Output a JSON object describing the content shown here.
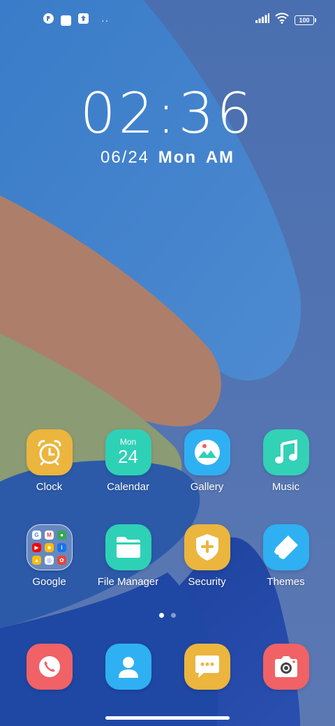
{
  "status_bar": {
    "left_icons": [
      "notification-app-icon",
      "notification-square-icon",
      "upload-icon",
      "more-notifications-icon"
    ],
    "battery": "100"
  },
  "clock": {
    "time": "02:36",
    "date": "06/24",
    "weekday": "Mon",
    "ampm": "AM"
  },
  "apps_row1": [
    {
      "label": "Clock",
      "color": "#EBB53E"
    },
    {
      "label": "Calendar",
      "color": "#2ED1B6",
      "month_abbr": "Mon",
      "day": "24"
    },
    {
      "label": "Gallery",
      "color": "#2FB0F2"
    },
    {
      "label": "Music",
      "color": "#33D1B6"
    }
  ],
  "apps_row2": [
    {
      "label": "Google",
      "folder_apps": [
        "G",
        "M",
        "Maps",
        "YT",
        "Meet",
        "i",
        "Drive",
        "Dup",
        "Photos"
      ]
    },
    {
      "label": "File Manager",
      "color": "#2ED1B6"
    },
    {
      "label": "Security",
      "color": "#EBB53E"
    },
    {
      "label": "Themes",
      "color": "#2FB0F2"
    }
  ],
  "dock": [
    {
      "name": "phone",
      "color": "#F06266"
    },
    {
      "name": "contacts",
      "color": "#2FB0F2"
    },
    {
      "name": "messages",
      "color": "#EBB53E"
    },
    {
      "name": "camera",
      "color": "#F06266"
    }
  ],
  "page_indicator": {
    "pages": 2,
    "current": 1
  }
}
